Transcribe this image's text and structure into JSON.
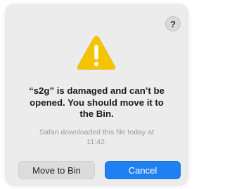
{
  "dialog": {
    "help_label": "?",
    "icon": "warning-triangle-icon",
    "title": "“s2g” is damaged and can’t be\nopened. You should move it to\nthe Bin.",
    "message": "Safari downloaded this file today at\n11:42.",
    "buttons": {
      "move_to_bin": "Move to Bin",
      "cancel": "Cancel"
    }
  },
  "colors": {
    "dialog_bg": "#ececec",
    "warning_yellow": "#f5c400",
    "primary_blue": "#1f80f2",
    "secondary_gray": "#dcdcdc"
  }
}
